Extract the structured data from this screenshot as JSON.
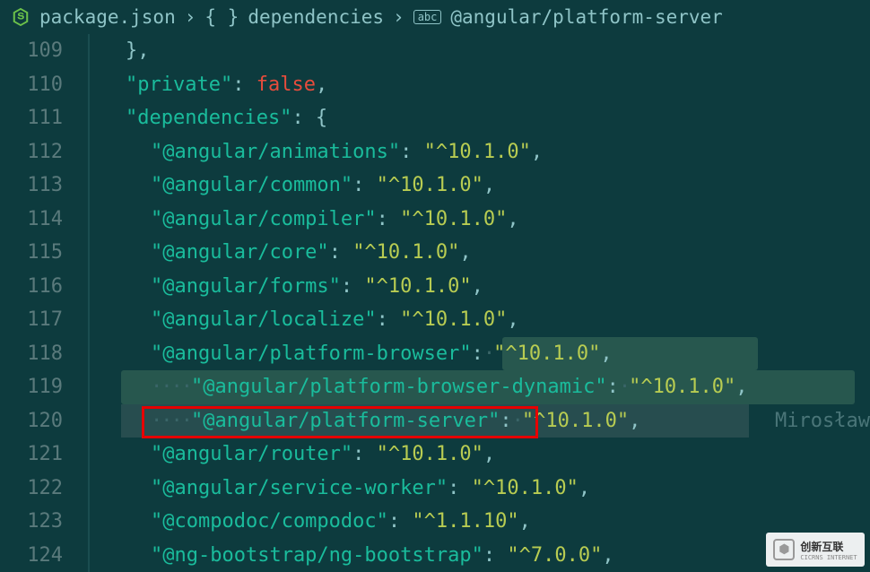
{
  "breadcrumb": {
    "file": "package.json",
    "section": "dependencies",
    "field": "@angular/platform-server"
  },
  "code": {
    "lines": [
      {
        "num": "109",
        "indent": 1,
        "raw_close": "},"
      },
      {
        "num": "110",
        "indent": 1,
        "key": "private",
        "bool": "false",
        "comma": ","
      },
      {
        "num": "111",
        "indent": 1,
        "key": "dependencies",
        "open": "{"
      },
      {
        "num": "112",
        "indent": 2,
        "key": "@angular/animations",
        "val": "^10.1.0",
        "comma": ","
      },
      {
        "num": "113",
        "indent": 2,
        "key": "@angular/common",
        "val": "^10.1.0",
        "comma": ","
      },
      {
        "num": "114",
        "indent": 2,
        "key": "@angular/compiler",
        "val": "^10.1.0",
        "comma": ","
      },
      {
        "num": "115",
        "indent": 2,
        "key": "@angular/core",
        "val": "^10.1.0",
        "comma": ","
      },
      {
        "num": "116",
        "indent": 2,
        "key": "@angular/forms",
        "val": "^10.1.0",
        "comma": ","
      },
      {
        "num": "117",
        "indent": 2,
        "key": "@angular/localize",
        "val": "^10.1.0",
        "comma": ","
      },
      {
        "num": "118",
        "indent": 2,
        "key": "@angular/platform-browser",
        "val": "^10.1.0",
        "comma": ",",
        "hl118": true,
        "dots_after": true
      },
      {
        "num": "119",
        "indent": 2,
        "key": "@angular/platform-browser-dynamic",
        "val": "^10.1.0",
        "comma": ",",
        "hl119": true,
        "dots_before": true,
        "dots_after": true
      },
      {
        "num": "120",
        "indent": 2,
        "key": "@angular/platform-server",
        "val": "^10.1.0",
        "comma": ",",
        "hl120": true,
        "redbox": true,
        "dots_before": true,
        "dots_after": true,
        "author": "Mirosław"
      },
      {
        "num": "121",
        "indent": 2,
        "key": "@angular/router",
        "val": "^10.1.0",
        "comma": ","
      },
      {
        "num": "122",
        "indent": 2,
        "key": "@angular/service-worker",
        "val": "^10.1.0",
        "comma": ","
      },
      {
        "num": "123",
        "indent": 2,
        "key": "@compodoc/compodoc",
        "val": "^1.1.10",
        "comma": ","
      },
      {
        "num": "124",
        "indent": 2,
        "key": "@ng-bootstrap/ng-bootstrap",
        "val": "^7.0.0",
        "comma": ","
      }
    ]
  },
  "watermark": {
    "brand": "创新互联",
    "sub": "CICRNS INTERNET"
  }
}
